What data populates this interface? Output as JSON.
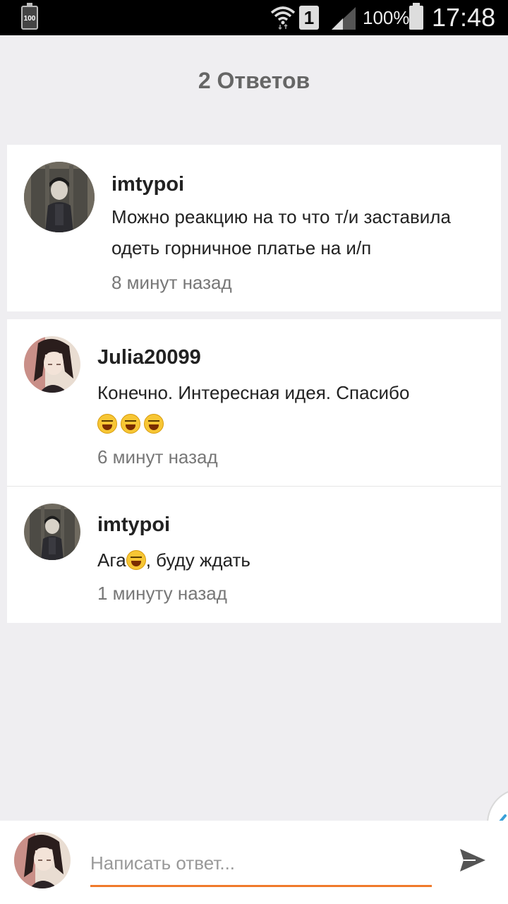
{
  "status_bar": {
    "battery_small_label": "100",
    "sim_label": "1",
    "battery_percent": "100%",
    "clock": "17:48"
  },
  "header": {
    "title": "2 Ответов"
  },
  "comments": [
    {
      "username": "imtypoi",
      "text": "Можно реакцию на то что т/и заставила одеть горничное платье на и/п",
      "time": "8 минут назад"
    },
    {
      "username": "Julia20099",
      "text": "Конечно. Интересная идея. Спасибо",
      "emoji_count": 3,
      "time": "6 минут назад"
    },
    {
      "username": "imtypoi",
      "text_before": "Ага",
      "text_after": ", буду ждать",
      "time": "1 минуту назад"
    }
  ],
  "reply": {
    "placeholder": "Написать ответ..."
  },
  "colors": {
    "accent": "#f07a2b",
    "background": "#efeef1",
    "card": "#ffffff"
  },
  "icons": {
    "send": "send-icon",
    "collapse": "chevron-left-icon",
    "wifi": "wifi-icon",
    "signal": "signal-icon",
    "battery": "battery-icon"
  }
}
